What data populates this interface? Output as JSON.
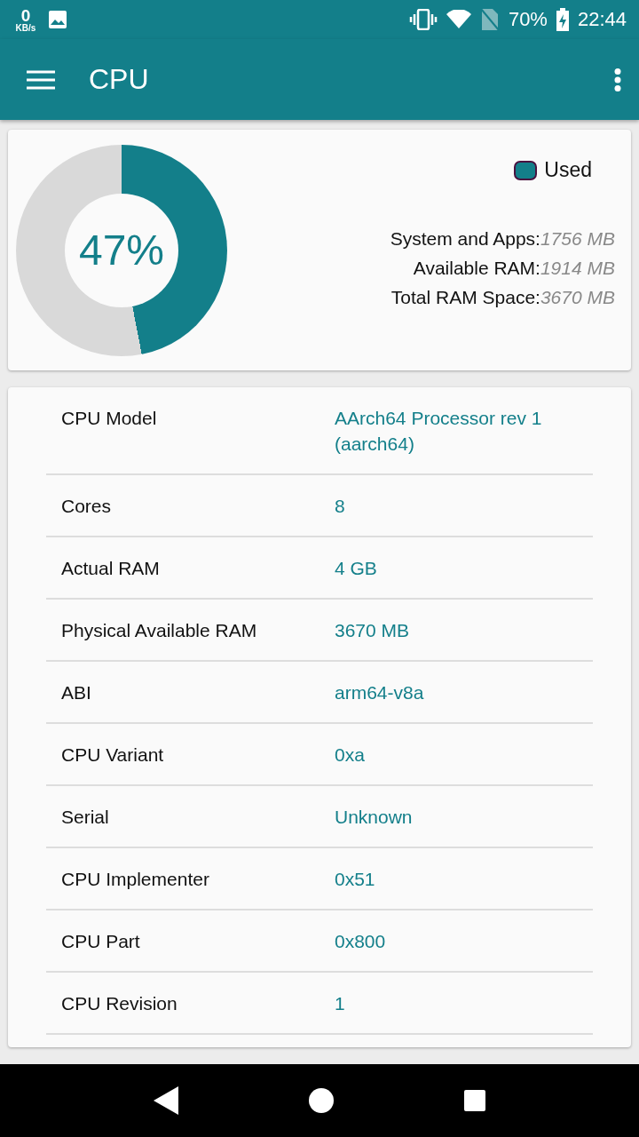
{
  "status_bar": {
    "speed_value": "0",
    "speed_unit": "KB/s",
    "battery": "70%",
    "time": "22:44"
  },
  "app_bar": {
    "title": "CPU"
  },
  "memory": {
    "percent": "47%",
    "legend": "Used",
    "stats": [
      {
        "label": "System and Apps:",
        "value": "1756 MB"
      },
      {
        "label": "Available RAM:",
        "value": "1914 MB"
      },
      {
        "label": "Total RAM Space:",
        "value": "3670 MB"
      }
    ]
  },
  "specs": [
    {
      "label": "CPU Model",
      "value": "AArch64 Processor rev 1 (aarch64)"
    },
    {
      "label": "Cores",
      "value": "8"
    },
    {
      "label": "Actual RAM",
      "value": "4 GB"
    },
    {
      "label": "Physical Available RAM",
      "value": "3670 MB"
    },
    {
      "label": "ABI",
      "value": "arm64-v8a"
    },
    {
      "label": "CPU Variant",
      "value": "0xa"
    },
    {
      "label": "Serial",
      "value": "Unknown"
    },
    {
      "label": "CPU Implementer",
      "value": "0x51"
    },
    {
      "label": "CPU Part",
      "value": "0x800"
    },
    {
      "label": "CPU Revision",
      "value": "1"
    }
  ]
}
